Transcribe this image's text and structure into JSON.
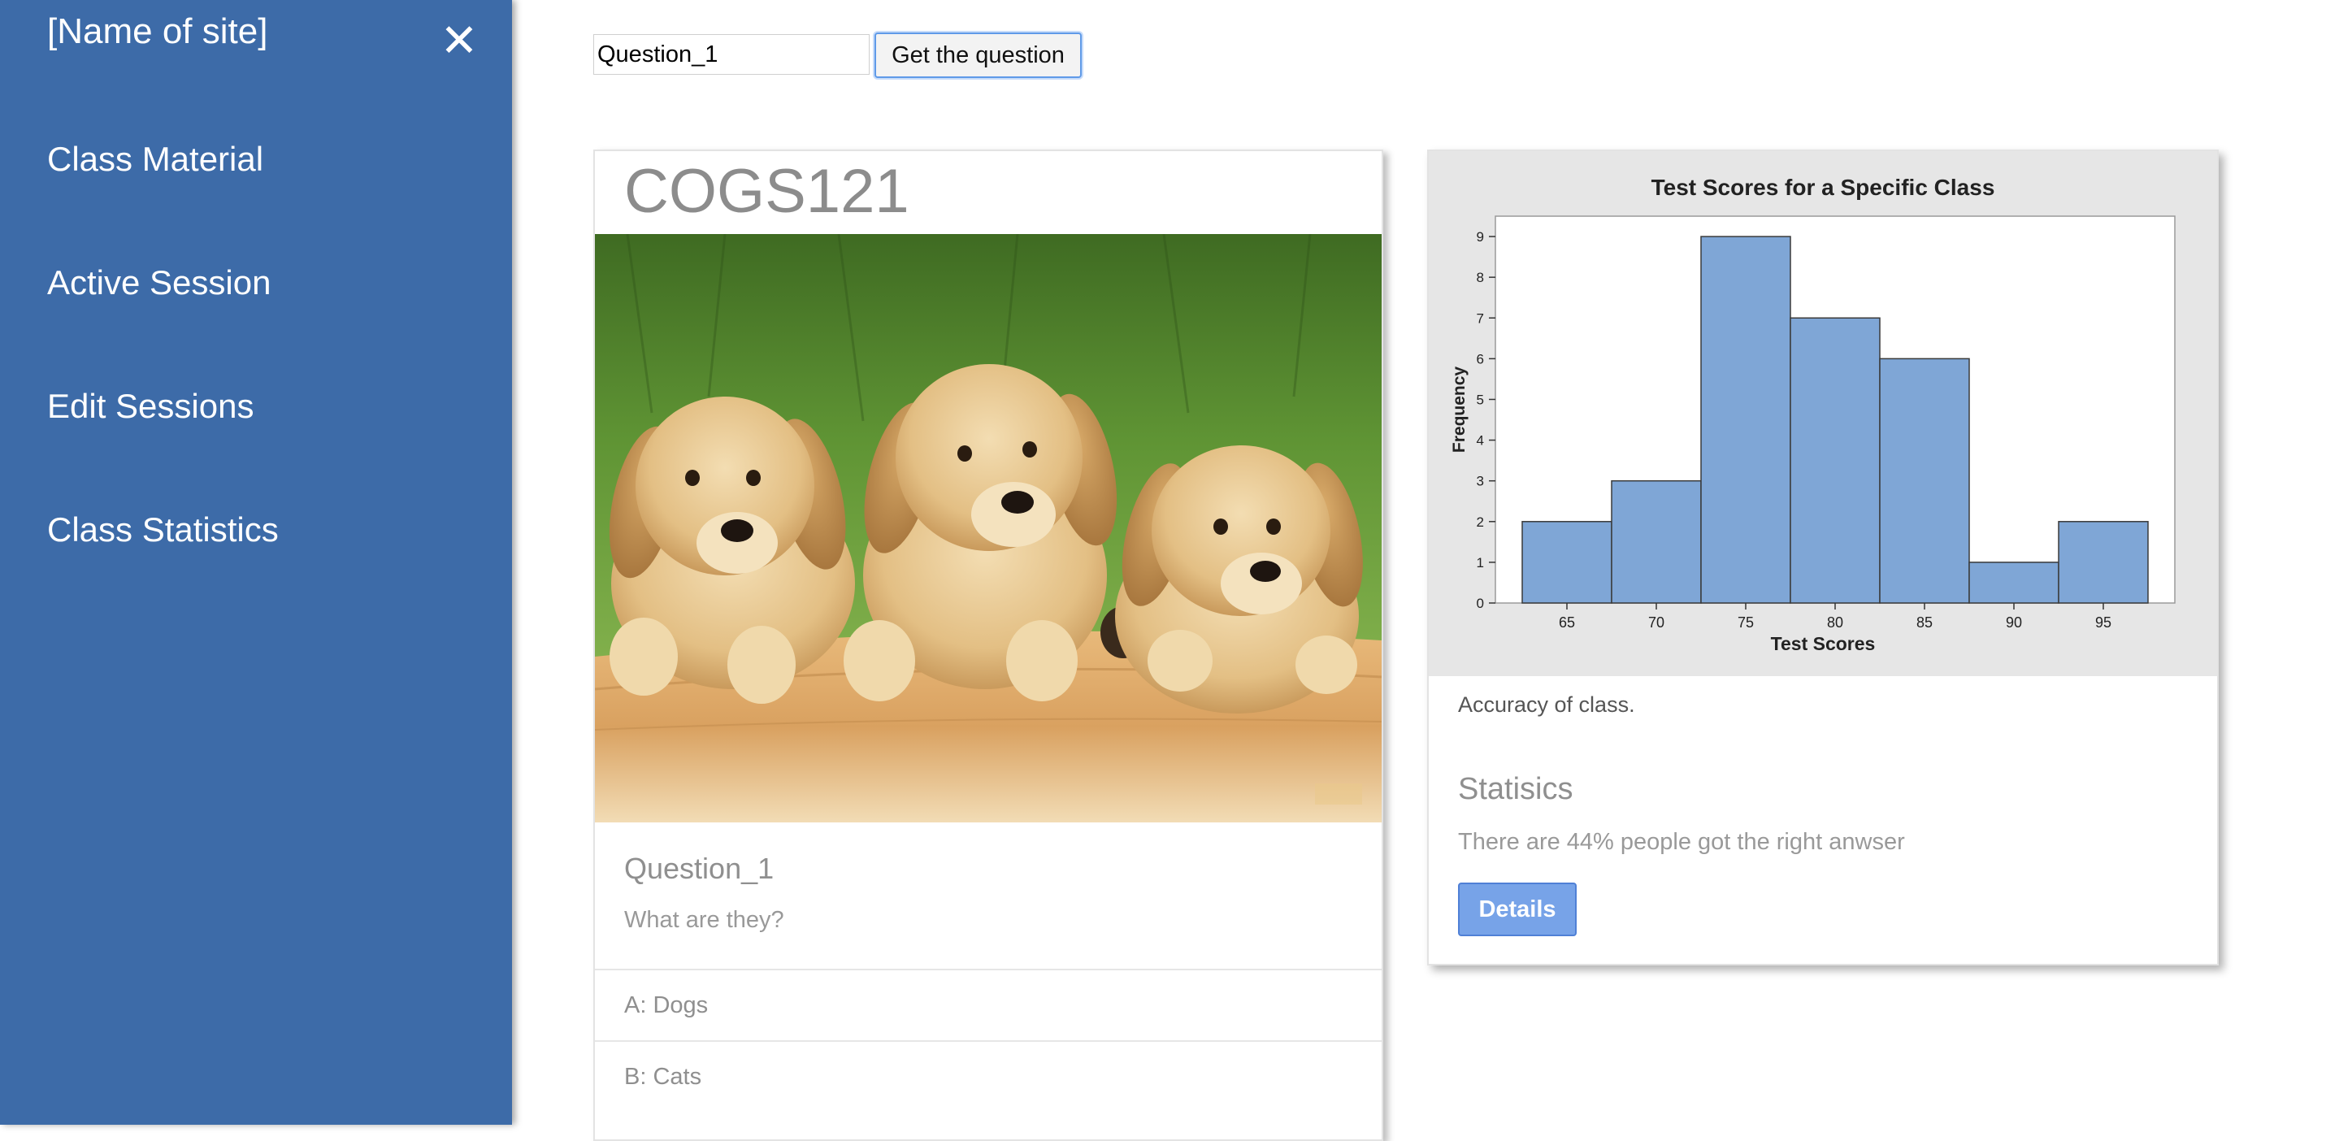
{
  "sidebar": {
    "site_name": "[Name of site]",
    "close_glyph": "✕",
    "items": [
      {
        "label": "Class Material"
      },
      {
        "label": "Active Session"
      },
      {
        "label": "Edit Sessions"
      },
      {
        "label": "Class Statistics"
      }
    ]
  },
  "question_form": {
    "input_value": "Question_1",
    "button_label": "Get the question"
  },
  "question_card": {
    "course": "COGS121",
    "image_icon": "puppies-photo",
    "question_title": "Question_1",
    "question_text": "What are they?",
    "options": [
      "A: Dogs",
      "B: Cats"
    ]
  },
  "stats_card": {
    "caption": "Accuracy of class.",
    "heading": "Statisics",
    "description": "There are 44% people got the right anwser",
    "details_label": "Details"
  },
  "chart_data": {
    "type": "bar",
    "title": "Test Scores for a Specific Class",
    "xlabel": "Test Scores",
    "ylabel": "Frequency",
    "bins": [
      [
        62.5,
        67.5
      ],
      [
        67.5,
        72.5
      ],
      [
        72.5,
        77.5
      ],
      [
        77.5,
        82.5
      ],
      [
        82.5,
        87.5
      ],
      [
        87.5,
        92.5
      ],
      [
        92.5,
        97.5
      ]
    ],
    "values": [
      2,
      3,
      9,
      7,
      6,
      1,
      2
    ],
    "x_ticks": [
      65,
      70,
      75,
      80,
      85,
      90,
      95
    ],
    "y_ticks": [
      0,
      1,
      2,
      3,
      4,
      5,
      6,
      7,
      8,
      9
    ],
    "xlim": [
      61,
      99
    ],
    "ylim": [
      0,
      9.5
    ],
    "grid": false,
    "bar_color": "#7fa6d6",
    "bar_edge_color": "#3a3a3a",
    "background_color": "#e6e6e6"
  },
  "colors": {
    "sidebar": "#3d6ba8",
    "accent": "#77a3e8"
  }
}
